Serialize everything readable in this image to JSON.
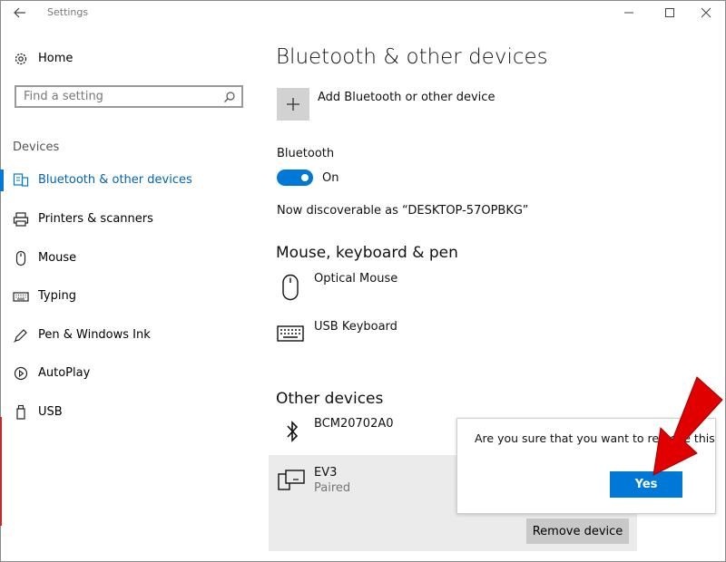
{
  "titlebar": {
    "title": "Settings"
  },
  "sidebar": {
    "home_label": "Home",
    "search_placeholder": "Find a setting",
    "section_label": "Devices",
    "items": [
      {
        "label": "Bluetooth & other devices",
        "icon": "bluetooth-devices-icon",
        "selected": true
      },
      {
        "label": "Printers & scanners",
        "icon": "printer-icon"
      },
      {
        "label": "Mouse",
        "icon": "mouse-icon"
      },
      {
        "label": "Typing",
        "icon": "keyboard-icon"
      },
      {
        "label": "Pen & Windows Ink",
        "icon": "pen-icon"
      },
      {
        "label": "AutoPlay",
        "icon": "autoplay-icon"
      },
      {
        "label": "USB",
        "icon": "usb-icon"
      }
    ]
  },
  "main": {
    "title": "Bluetooth & other devices",
    "add_device_label": "Add Bluetooth or other device",
    "bluetooth_label": "Bluetooth",
    "bluetooth_state": "On",
    "discoverable_text": "Now discoverable as “DESKTOP-57OPBKG”",
    "mouse_keyboard_section": "Mouse, keyboard & pen",
    "mouse_keyboard_devices": [
      {
        "name": "Optical Mouse",
        "icon": "mouse-icon"
      },
      {
        "name": "USB Keyboard",
        "icon": "keyboard-icon"
      }
    ],
    "other_devices_section": "Other devices",
    "other_devices": [
      {
        "name": "BCM20702A0",
        "icon": "bluetooth-icon"
      },
      {
        "name": "EV3",
        "status": "Paired",
        "icon": "device-icon"
      }
    ],
    "remove_button": "Remove device"
  },
  "popup": {
    "message": "Are you sure that you want to remove this device?",
    "yes_button": "Yes"
  },
  "colors": {
    "accent": "#0078d7",
    "arrow": "#e00000"
  }
}
